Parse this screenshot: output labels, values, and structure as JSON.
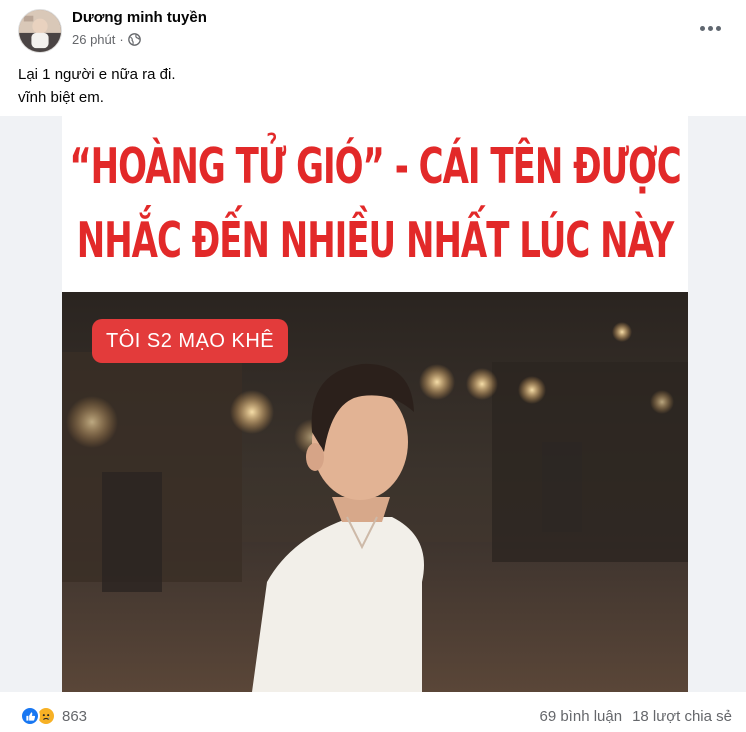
{
  "post": {
    "author": "Dương minh tuyền",
    "time": "26 phút",
    "separator": "·",
    "privacy_icon": "globe-icon",
    "more_icon": "ellipsis-icon",
    "text_lines": [
      "Lại 1 người e nữa ra đi.",
      "vĩnh biệt em."
    ]
  },
  "image": {
    "headline_line1": "“HOÀNG TỬ GIÓ” - CÁI TÊN ĐƯỢC",
    "headline_line2": "NHẮC ĐẾN NHIỀU NHẤT LÚC NÀY",
    "pill_text": "TÔI S2 MẠO KHÊ",
    "headline_color": "#e22929",
    "pill_color": "#e33b3b"
  },
  "footer": {
    "reactions": [
      "like-icon",
      "sad-icon"
    ],
    "reaction_count": "863",
    "comments": "69 bình luận",
    "shares": "18 lượt chia sẻ"
  }
}
